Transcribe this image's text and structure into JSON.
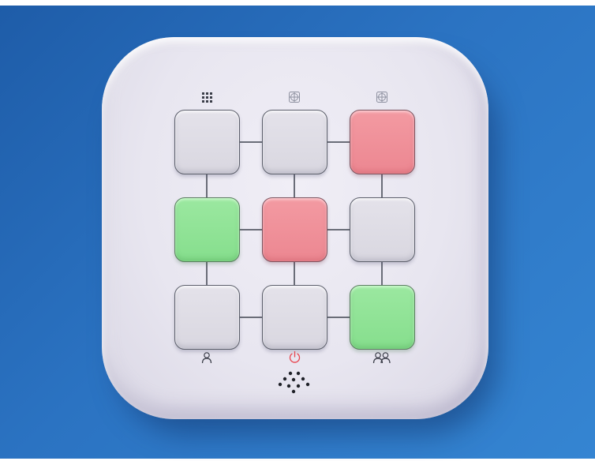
{
  "board": {
    "rows": [
      [
        "gray",
        "gray",
        "red"
      ],
      [
        "green",
        "red",
        "gray"
      ],
      [
        "gray",
        "gray",
        "green"
      ]
    ]
  },
  "colors": {
    "background": "#2b73c2",
    "device": "#e8e6f0",
    "tile_gray": "#dcdae3",
    "tile_red": "#ef8e97",
    "tile_green": "#90e296",
    "power_icon": "#e8454f",
    "icon_dark": "#3a3d48",
    "icon_light": "#8e91a0"
  },
  "icons": {
    "top": [
      "grid-icon",
      "target-icon",
      "target-icon"
    ],
    "bottom": [
      "user-icon",
      "power-icon",
      "users-icon"
    ],
    "speaker": "speaker-grille-icon"
  }
}
